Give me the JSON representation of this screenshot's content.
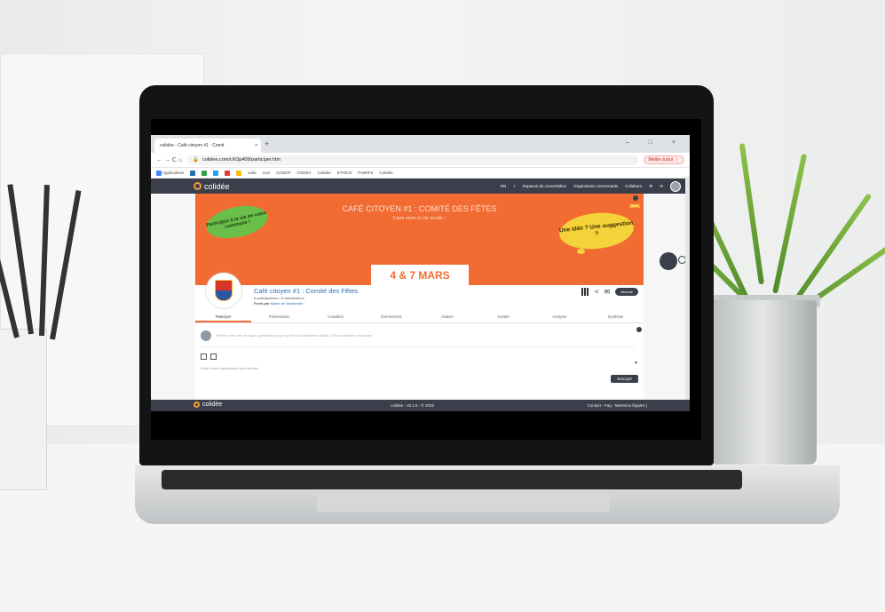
{
  "browser": {
    "tab_title": "colidée - Café citoyen #1 : Comit",
    "tab_close": "×",
    "new_tab": "+",
    "window_controls": "– □ ×",
    "nav": "← → C ⌂",
    "url": "colidee.com/c/63p409/participer.htm",
    "update_button": "Mettre à jour ⋮"
  },
  "bookmarks": [
    "Applications",
    "suite",
    "Live",
    "CONOP",
    "CODEV",
    "Colidée",
    "ETHICS",
    "FAIRIFS",
    "Colidée"
  ],
  "app": {
    "logo": "colidée",
    "nav": {
      "lang": "EN",
      "spaces": "Espaces de concertation",
      "orgs": "Organismes concernants",
      "colideurs": "Colideurs"
    }
  },
  "banner": {
    "title": "CAFÉ CITOYEN #1 : COMITÉ DES FÊTES",
    "subtitle": "Faire vivre la vie locale !",
    "bubble_left": "Participez à la vie de votre commune !",
    "bubble_right": "Une idée ? Une suggestion ?",
    "date": "4 & 7 MARS",
    "badge": "NEW"
  },
  "profile": {
    "title": "Café citoyen #1 : Comité des Fêtes",
    "meta": "8 participations • 8 contributeurs",
    "organizer_prefix": "Porté par ",
    "organizer": "Mairie de Mondeville",
    "follow": "Abonné"
  },
  "tabs": [
    "Participer",
    "Présentation",
    "Actualités",
    "Événements",
    "Galerie",
    "Sonder",
    "Analyser",
    "Synthèse"
  ],
  "composer": {
    "placeholder": "Écrire votre idée de façon synthétique pour qu'elle soit facilement lisible (255 caractères maximum)",
    "select_placeholder": "Relier votre participation aux thèmes",
    "send": "Envoyer"
  },
  "footer": {
    "logo": "colidée",
    "version": "colidée - v5.1.5 - © 2020",
    "links": "Contact - Faq - Mentions légales |"
  },
  "colors": {
    "banner": "#f26b32",
    "appbar": "#3a3f4b",
    "bubble_left": "#6abf4b",
    "bubble_right": "#f4d23a"
  }
}
